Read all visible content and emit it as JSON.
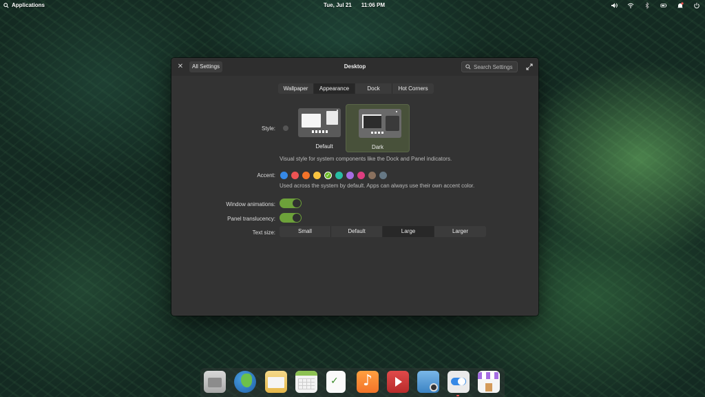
{
  "panel": {
    "applications_label": "Applications",
    "date": "Tue, Jul 21",
    "time": "11:06 PM",
    "indicators": [
      "volume-icon",
      "wifi-icon",
      "bluetooth-icon",
      "battery-icon",
      "notifications-icon",
      "power-icon"
    ]
  },
  "window": {
    "title": "Desktop",
    "back_label": "All Settings",
    "search_placeholder": "Search Settings",
    "tabs": [
      {
        "label": "Wallpaper",
        "active": false
      },
      {
        "label": "Appearance",
        "active": true
      },
      {
        "label": "Dock",
        "active": false
      },
      {
        "label": "Hot Corners",
        "active": false
      }
    ],
    "style": {
      "label": "Style:",
      "options": [
        {
          "label": "Default",
          "selected": false
        },
        {
          "label": "Dark",
          "selected": true
        }
      ],
      "description": "Visual style for system components like the Dock and Panel indicators."
    },
    "accent": {
      "label": "Accent:",
      "colors": [
        "#3689e6",
        "#ed5353",
        "#f37329",
        "#f9c440",
        "#68b723",
        "#28bca3",
        "#a56de2",
        "#de3e80",
        "#8a715e",
        "#667885"
      ],
      "selected_index": 4,
      "description": "Used across the system by default. Apps can always use their own accent color."
    },
    "window_animations": {
      "label": "Window animations:",
      "on": true
    },
    "panel_translucency": {
      "label": "Panel translucency:",
      "on": true
    },
    "text_size": {
      "label": "Text size:",
      "options": [
        "Small",
        "Default",
        "Large",
        "Larger"
      ],
      "selected": "Large"
    }
  },
  "dock": {
    "items": [
      "files-icon",
      "web-browser-icon",
      "mail-icon",
      "calendar-icon",
      "tasks-icon",
      "music-icon",
      "videos-icon",
      "photos-icon",
      "system-settings-icon",
      "appcenter-icon"
    ],
    "colors": {
      "accent": "#68b723",
      "window_bg": "#333333"
    }
  }
}
